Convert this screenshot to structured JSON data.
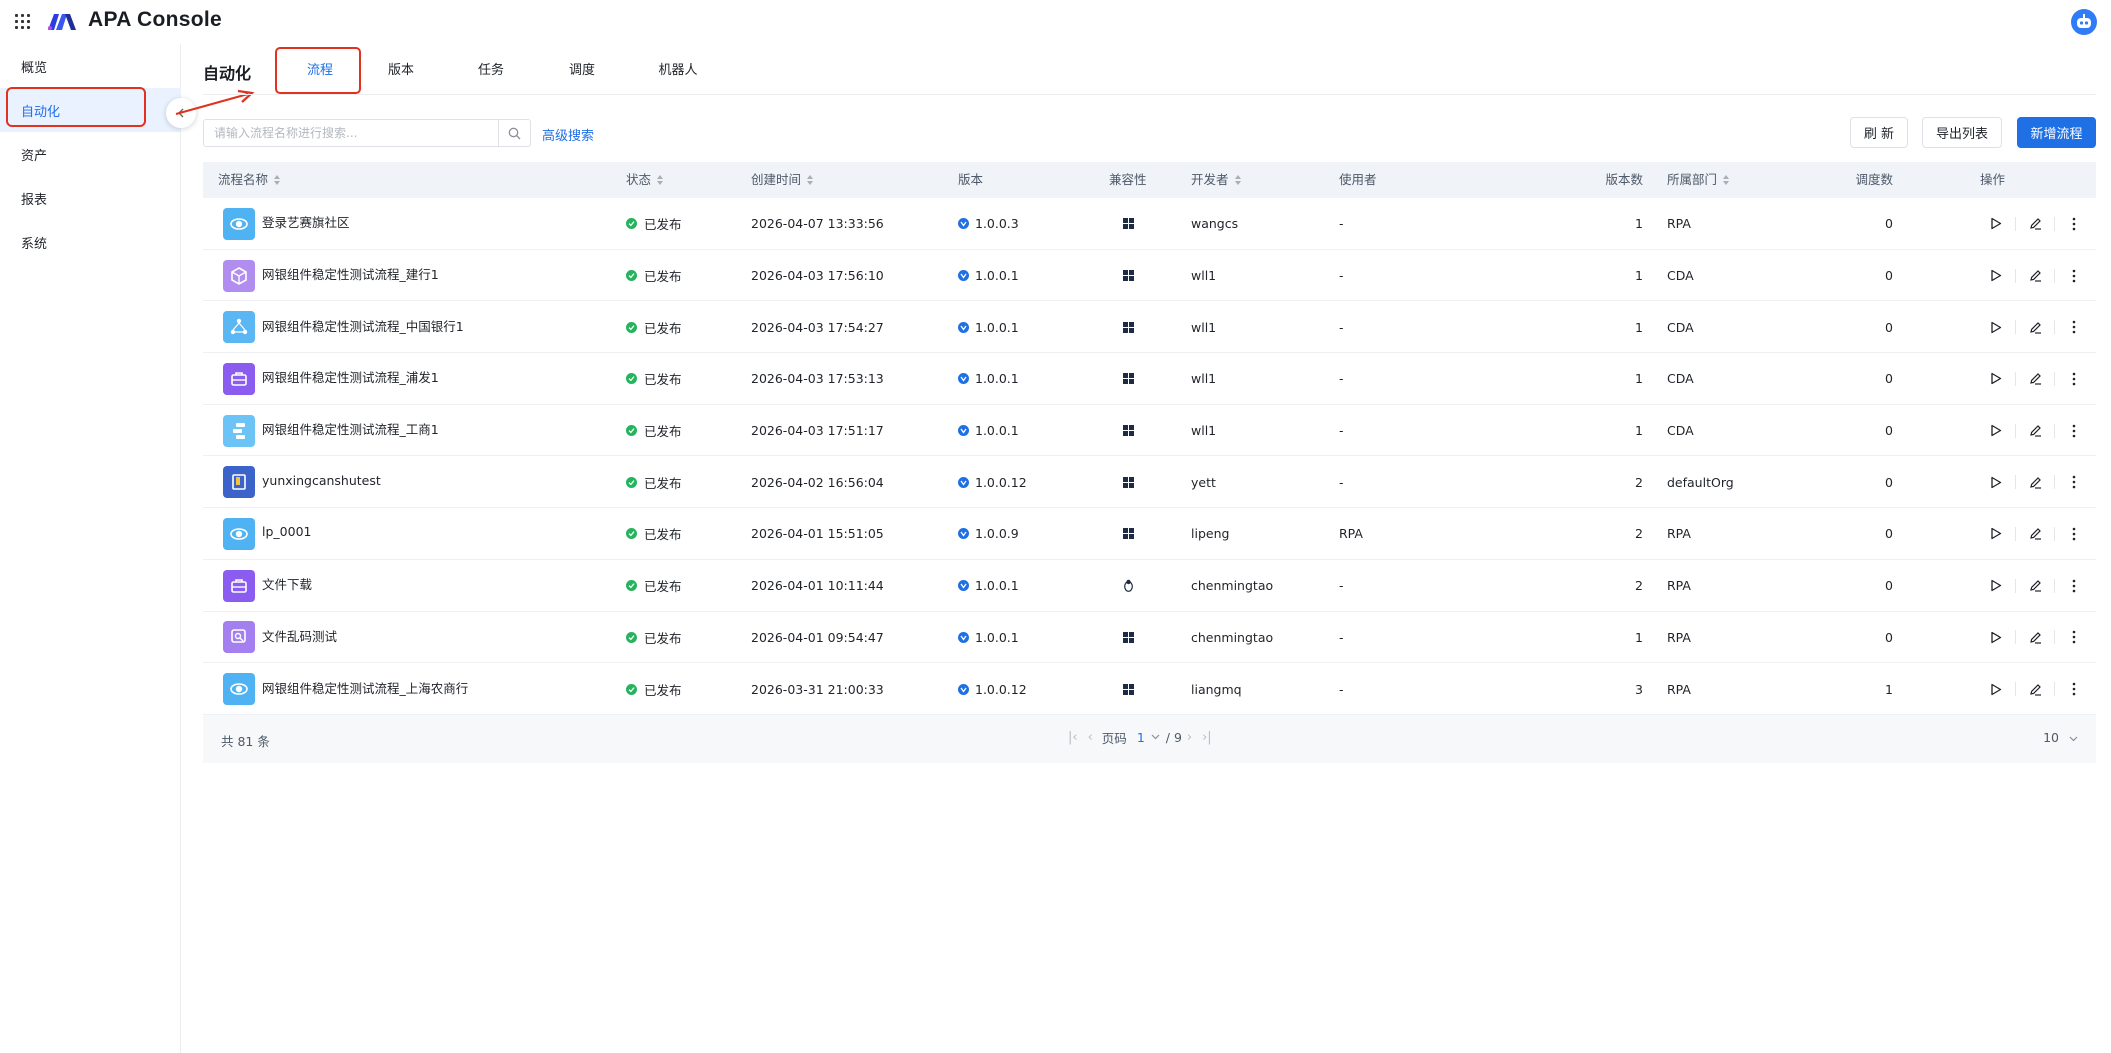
{
  "app": {
    "title": "APA Console"
  },
  "sidebar": {
    "items": [
      {
        "label": "概览"
      },
      {
        "label": "自动化"
      },
      {
        "label": "资产"
      },
      {
        "label": "报表"
      },
      {
        "label": "系统"
      }
    ],
    "active_index": 1
  },
  "header": {
    "section_title": "自动化",
    "tabs": [
      {
        "label": "流程"
      },
      {
        "label": "版本"
      },
      {
        "label": "任务"
      },
      {
        "label": "调度"
      },
      {
        "label": "机器人"
      }
    ],
    "active_tab": 0
  },
  "toolbar": {
    "search_placeholder": "请输入流程名称进行搜索...",
    "advanced_search": "高级搜索",
    "refresh": "刷 新",
    "export": "导出列表",
    "add": "新增流程"
  },
  "table": {
    "columns": {
      "name": "流程名称",
      "status": "状态",
      "created": "创建时间",
      "version": "版本",
      "compat": "兼容性",
      "developer": "开发者",
      "user": "使用者",
      "version_count": "版本数",
      "dept": "所属部门",
      "schedule_count": "调度数",
      "ops": "操作"
    },
    "rows": [
      {
        "name": "登录艺赛旗社区",
        "icon": "globe-icon",
        "icon_color": "#4fb2f2",
        "status": "已发布",
        "created": "2026-04-07 13:33:56",
        "version": "1.0.0.3",
        "compat": "windows",
        "developer": "wangcs",
        "user": "-",
        "version_count": "1",
        "dept": "RPA",
        "schedule_count": "0"
      },
      {
        "name": "网银组件稳定性测试流程_建行1",
        "icon": "cube-icon",
        "icon_color": "#b18df0",
        "status": "已发布",
        "created": "2026-04-03 17:56:10",
        "version": "1.0.0.1",
        "compat": "windows",
        "developer": "wll1",
        "user": "-",
        "version_count": "1",
        "dept": "CDA",
        "schedule_count": "0"
      },
      {
        "name": "网银组件稳定性测试流程_中国银行1",
        "icon": "network-icon",
        "icon_color": "#5ab7f4",
        "status": "已发布",
        "created": "2026-04-03 17:54:27",
        "version": "1.0.0.1",
        "compat": "windows",
        "developer": "wll1",
        "user": "-",
        "version_count": "1",
        "dept": "CDA",
        "schedule_count": "0"
      },
      {
        "name": "网银组件稳定性测试流程_浦发1",
        "icon": "briefcase-icon",
        "icon_color": "#8b5cf0",
        "status": "已发布",
        "created": "2026-04-03 17:53:13",
        "version": "1.0.0.1",
        "compat": "windows",
        "developer": "wll1",
        "user": "-",
        "version_count": "1",
        "dept": "CDA",
        "schedule_count": "0"
      },
      {
        "name": "网银组件稳定性测试流程_工商1",
        "icon": "flow-icon",
        "icon_color": "#6cc3f5",
        "status": "已发布",
        "created": "2026-04-03 17:51:17",
        "version": "1.0.0.1",
        "compat": "windows",
        "developer": "wll1",
        "user": "-",
        "version_count": "1",
        "dept": "CDA",
        "schedule_count": "0"
      },
      {
        "name": "yunxingcanshutest",
        "icon": "book-icon",
        "icon_color": "#3c63c9",
        "status": "已发布",
        "created": "2026-04-02 16:56:04",
        "version": "1.0.0.12",
        "compat": "windows",
        "developer": "yett",
        "user": "-",
        "version_count": "2",
        "dept": "defaultOrg",
        "schedule_count": "0"
      },
      {
        "name": "lp_0001",
        "icon": "globe-icon",
        "icon_color": "#4fb2f2",
        "status": "已发布",
        "created": "2026-04-01 15:51:05",
        "version": "1.0.0.9",
        "compat": "windows",
        "developer": "lipeng",
        "user": "RPA",
        "version_count": "2",
        "dept": "RPA",
        "schedule_count": "0"
      },
      {
        "name": "文件下载",
        "icon": "briefcase-icon",
        "icon_color": "#8b5cf0",
        "status": "已发布",
        "created": "2026-04-01 10:11:44",
        "version": "1.0.0.1",
        "compat": "linux",
        "developer": "chenmingtao",
        "user": "-",
        "version_count": "2",
        "dept": "RPA",
        "schedule_count": "0"
      },
      {
        "name": "文件乱码测试",
        "icon": "search-doc-icon",
        "icon_color": "#a47ff0",
        "status": "已发布",
        "created": "2026-04-01 09:54:47",
        "version": "1.0.0.1",
        "compat": "windows",
        "developer": "chenmingtao",
        "user": "-",
        "version_count": "1",
        "dept": "RPA",
        "schedule_count": "0"
      },
      {
        "name": "网银组件稳定性测试流程_上海农商行",
        "icon": "globe-icon",
        "icon_color": "#4fb2f2",
        "status": "已发布",
        "created": "2026-03-31 21:00:33",
        "version": "1.0.0.12",
        "compat": "windows",
        "developer": "liangmq",
        "user": "-",
        "version_count": "3",
        "dept": "RPA",
        "schedule_count": "1"
      }
    ]
  },
  "pagination": {
    "total_label": "共 81 条",
    "page_label": "页码",
    "current_page": "1",
    "total_pages": "/ 9",
    "page_size": "10"
  },
  "colors": {
    "accent": "#1f6fe5",
    "success": "#23b45d",
    "annotation": "#e0321f"
  }
}
